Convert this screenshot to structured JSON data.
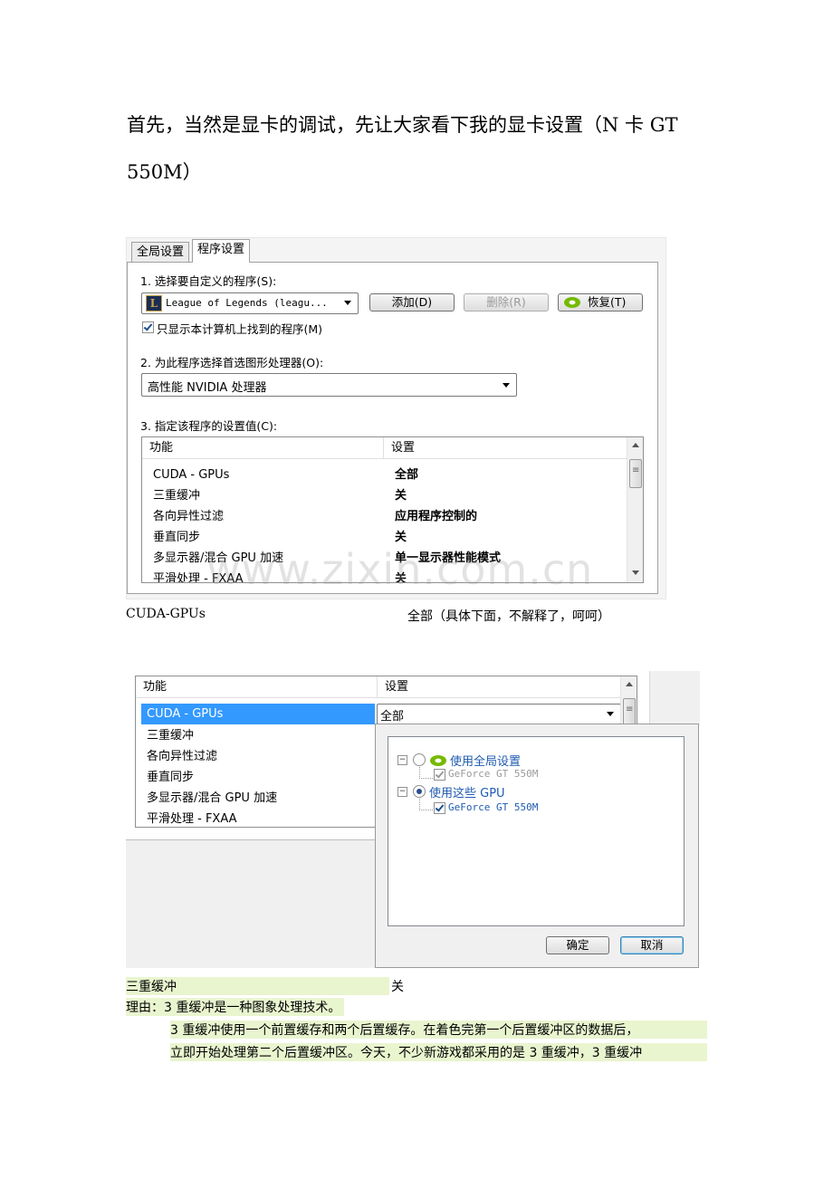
{
  "intro": {
    "line1": "首先，当然是显卡的调试，先让大家看下我的显卡设置（N 卡 GT",
    "line2": "550M）"
  },
  "shot1": {
    "tabs": [
      "全局设置",
      "程序设置"
    ],
    "step1_label": "1. 选择要自定义的程序(S):",
    "program_value": "League of Legends (leagu...",
    "btn_add": "添加(D)",
    "btn_delete": "删除(R)",
    "btn_restore": "恢复(T)",
    "only_local_label": "只显示本计算机上找到的程序(M)",
    "step2_label": "2. 为此程序选择首选图形处理器(O):",
    "gpu_value": "高性能 NVIDIA 处理器",
    "step3_label": "3. 指定该程序的设置值(C):",
    "col_feature": "功能",
    "col_setting": "设置",
    "rows": [
      {
        "feature": "CUDA - GPUs",
        "setting": "全部"
      },
      {
        "feature": "三重缓冲",
        "setting": "关"
      },
      {
        "feature": "各向异性过滤",
        "setting": "应用程序控制的"
      },
      {
        "feature": "垂直同步",
        "setting": "关"
      },
      {
        "feature": "多显示器/混合 GPU 加速",
        "setting": "单一显示器性能模式"
      },
      {
        "feature": "平滑处理 - FXAA",
        "setting": "关"
      }
    ],
    "watermark": "www.zixin.com.cn"
  },
  "caption1": {
    "left": "CUDA-GPUs",
    "right": "全部（具体下面，不解释了，呵呵）"
  },
  "shot2": {
    "col_feature": "功能",
    "col_setting": "设置",
    "rows": [
      "CUDA - GPUs",
      "三重缓冲",
      "各向异性过滤",
      "垂直同步",
      "多显示器/混合 GPU 加速",
      "平滑处理 - FXAA"
    ],
    "selected_setting": "全部",
    "opt_global": "使用全局设置",
    "opt_global_gpu": "GeForce GT 550M",
    "opt_these": "使用这些 GPU",
    "opt_these_gpu": "GeForce GT 550M",
    "btn_ok": "确定",
    "btn_cancel": "取消"
  },
  "caption2": {
    "left": "三重缓冲",
    "right": "关"
  },
  "body": {
    "reason": "理由：3 重缓冲是一种图象处理技术。",
    "para_line1": "3 重缓冲使用一个前置缓存和两个后置缓存。在着色完第一个后置缓冲区的数据后，",
    "para_line2": "立即开始处理第二个后置缓冲区。今天，不少新游戏都采用的是 3 重缓冲，3 重缓冲"
  },
  "colors": {
    "selection": "#3399ff",
    "highlight": "#e9f5cf",
    "nvidia_green": "#76b900",
    "link_blue": "#1e5bb0"
  }
}
